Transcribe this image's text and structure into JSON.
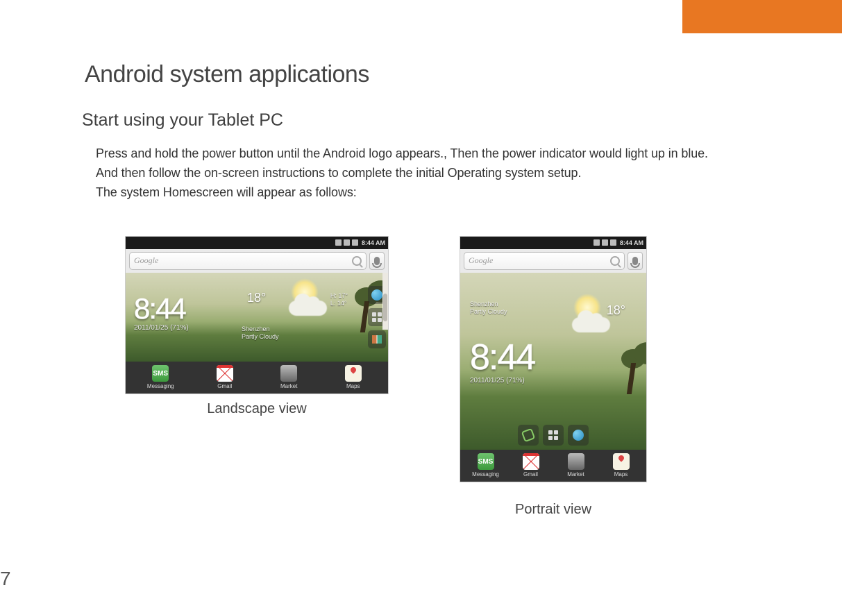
{
  "page_number": "7",
  "title": "Android system applications",
  "subtitle": "Start using your Tablet PC",
  "paragraphs": {
    "p1": " Press and hold the power button until the Android logo appears., Then the power indicator would light up in blue.",
    "p2": "And then follow the on-screen instructions to complete the initial Operating system setup.",
    "p3": "The system Homescreen will appear as follows:"
  },
  "captions": {
    "landscape": "Landscape view",
    "portrait": "Portrait  view"
  },
  "screenshot": {
    "status_time": "8:44",
    "status_ampm": "AM",
    "search_logo": "Google",
    "clock_time": "8:44",
    "clock_date": "2011/01/25 (71%)",
    "temp": "18°",
    "hi": "H: 17°",
    "lo": "L: 14°",
    "location_city": "Shenzhen",
    "location_cond": "Partly Cloudy",
    "dock": {
      "messaging": "Messaging",
      "gmail": "Gmail",
      "market": "Market",
      "maps": "Maps"
    },
    "sms_badge": "SMS"
  }
}
